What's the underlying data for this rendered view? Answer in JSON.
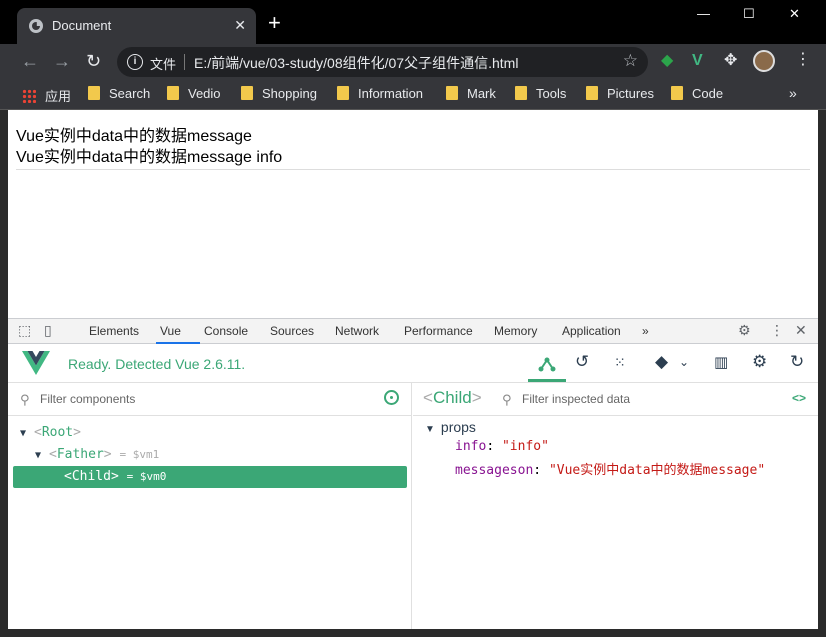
{
  "tab": {
    "title": "Document",
    "close": "✕",
    "new": "+"
  },
  "window_controls": {
    "minimize": "—",
    "maximize": "☐",
    "close": "✕"
  },
  "omnibox": {
    "security_label": "文件",
    "url": "E:/前端/vue/03-study/08组件化/07父子组件通信.html"
  },
  "bookmarks": {
    "apps": "应用",
    "items": [
      "Search",
      "Vedio",
      "Shopping",
      "Information",
      "Mark",
      "Tools",
      "Pictures",
      "Code"
    ],
    "more": "»"
  },
  "page": {
    "line1": "Vue实例中data中的数据message",
    "line2": "Vue实例中data中的数据message info"
  },
  "devtools": {
    "tabs": [
      "Elements",
      "Vue",
      "Console",
      "Sources",
      "Network",
      "Performance",
      "Memory",
      "Application"
    ],
    "active_tab": "Vue",
    "overflow": "»"
  },
  "vue": {
    "status": "Ready. Detected Vue 2.6.11.",
    "filter_components": "Filter components",
    "filter_data": "Filter inspected data",
    "tree": {
      "root": "Root",
      "father": "Father",
      "father_ref": "= $vm1",
      "child": "Child",
      "child_ref": "= $vm0"
    },
    "inspected": {
      "component": "Child",
      "section": "props",
      "props": [
        {
          "key": "info",
          "value": "\"info\""
        },
        {
          "key": "messageson",
          "value": "\"Vue实例中data中的数据message\""
        }
      ]
    }
  },
  "colors": {
    "vue_green": "#3ba776",
    "chrome_dark": "#35363a",
    "accent_blue": "#1a73e8"
  }
}
